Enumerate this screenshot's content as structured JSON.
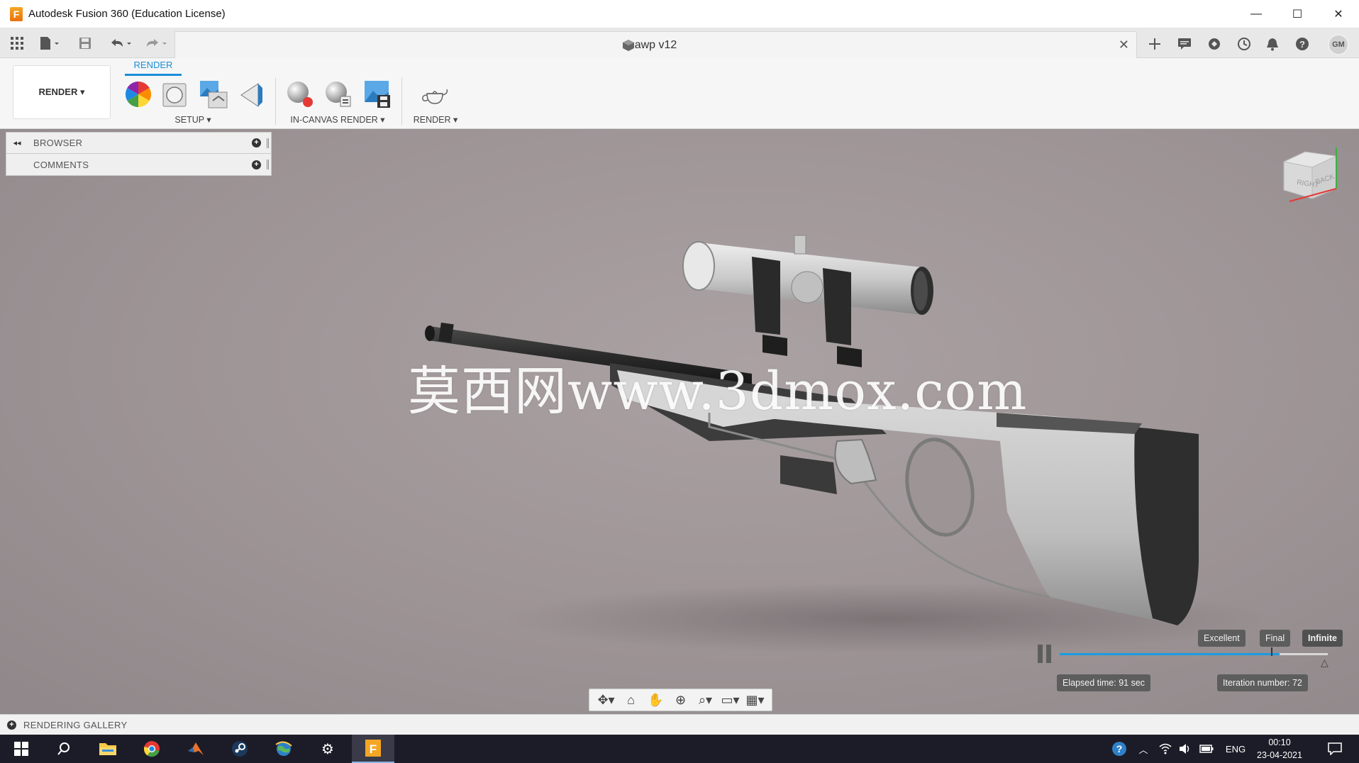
{
  "window": {
    "title": "Autodesk Fusion 360 (Education License)",
    "logo_letter": "F",
    "minimize": "—",
    "maximize": "☐",
    "close": "✕"
  },
  "document": {
    "tab_title": "awp v12",
    "close": "✕",
    "user_initials": "GM"
  },
  "ribbon": {
    "workspace_label": "RENDER ▾",
    "active_tab": "RENDER",
    "groups": {
      "setup": "SETUP ▾",
      "in_canvas": "IN-CANVAS RENDER ▾",
      "render": "RENDER ▾"
    }
  },
  "browser_panel": {
    "items": [
      {
        "label": "BROWSER",
        "lead": "◂◂",
        "add": "+"
      },
      {
        "label": "COMMENTS",
        "lead": "",
        "add": "+"
      }
    ]
  },
  "viewcube": {
    "faces": [
      "RIGHT",
      "BACK"
    ]
  },
  "watermark": "莫西网www.3dmox.com",
  "render_controls": {
    "quality": [
      "Excellent",
      "Final",
      "Infinite"
    ],
    "selected_quality": "Infinite",
    "progress": 0.82,
    "elapsed": "Elapsed time: 91 sec",
    "iteration": "Iteration number: 72"
  },
  "gallery": {
    "label": "RENDERING GALLERY",
    "add": "+"
  },
  "taskbar": {
    "language": "ENG",
    "time": "00:10",
    "date": "23-04-2021"
  },
  "colors": {
    "accent": "#1a8dd8",
    "viewport_bg": "#9d9496",
    "taskbar_bg": "#1c1c28"
  }
}
